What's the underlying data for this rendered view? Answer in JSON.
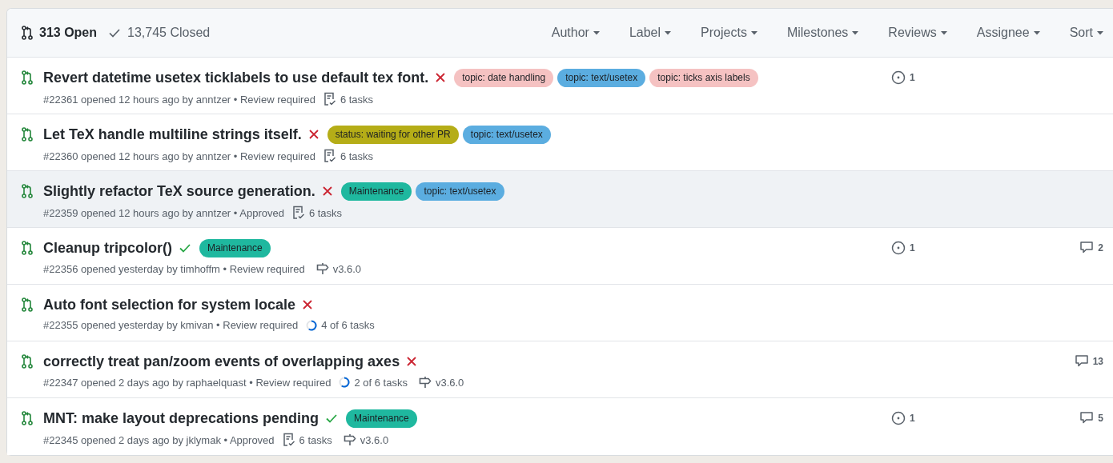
{
  "header": {
    "open_count": "313 Open",
    "closed_count": "13,745 Closed",
    "filters": [
      "Author",
      "Label",
      "Projects",
      "Milestones",
      "Reviews",
      "Assignee",
      "Sort"
    ]
  },
  "pull_requests": [
    {
      "title": "Revert datetime usetex ticklabels to use default tex font.",
      "kind": "failure",
      "selected": false,
      "labels": [
        {
          "name": "topic: date handling",
          "color": "#f5c2c2"
        },
        {
          "name": "topic: text/usetex",
          "color": "#5bade0"
        },
        {
          "name": "topic: ticks axis labels",
          "color": "#f5c2c2"
        }
      ],
      "meta": "#22361 opened 12 hours ago by anntzer • Review required",
      "tasks": {
        "kind": "checklist",
        "text": "6 tasks"
      },
      "linked_issues": "1"
    },
    {
      "title": "Let TeX handle multiline strings itself.",
      "kind": "failure",
      "selected": false,
      "labels": [
        {
          "name": "status: waiting for other PR",
          "color": "#b5ad17"
        },
        {
          "name": "topic: text/usetex",
          "color": "#5bade0"
        }
      ],
      "meta": "#22360 opened 12 hours ago by anntzer • Review required",
      "tasks": {
        "kind": "checklist",
        "text": "6 tasks"
      }
    },
    {
      "title": "Slightly refactor TeX source generation.",
      "kind": "failure",
      "selected": true,
      "labels": [
        {
          "name": "Maintenance",
          "color": "#1fb89f"
        },
        {
          "name": "topic: text/usetex",
          "color": "#5bade0"
        }
      ],
      "meta": "#22359 opened 12 hours ago by anntzer • Approved",
      "tasks": {
        "kind": "checklist",
        "text": "6 tasks"
      }
    },
    {
      "title": "Cleanup tripcolor()",
      "kind": "success",
      "selected": false,
      "labels": [
        {
          "name": "Maintenance",
          "color": "#1fb89f"
        }
      ],
      "meta": "#22356 opened yesterday by timhoffm • Review required",
      "milestone": "v3.6.0",
      "linked_issues": "1",
      "comments": "2"
    },
    {
      "title": "Auto font selection for system locale",
      "kind": "failure",
      "selected": false,
      "meta": "#22355 opened yesterday by kmivan • Review required",
      "tasks": {
        "kind": "progress",
        "text": "4 of 6 tasks"
      }
    },
    {
      "title": "correctly treat pan/zoom events of overlapping axes",
      "kind": "failure",
      "selected": false,
      "meta": "#22347 opened 2 days ago by raphaelquast • Review required",
      "tasks": {
        "kind": "progress",
        "text": "2 of 6 tasks"
      },
      "milestone": "v3.6.0",
      "comments": "13"
    },
    {
      "title": "MNT: make layout deprecations pending",
      "kind": "success",
      "selected": false,
      "labels": [
        {
          "name": "Maintenance",
          "color": "#1fb89f"
        }
      ],
      "meta": "#22345 opened 2 days ago by jklymak • Approved",
      "tasks": {
        "kind": "checklist",
        "text": "6 tasks"
      },
      "milestone": "v3.6.0",
      "linked_issues": "1",
      "comments": "5"
    }
  ]
}
